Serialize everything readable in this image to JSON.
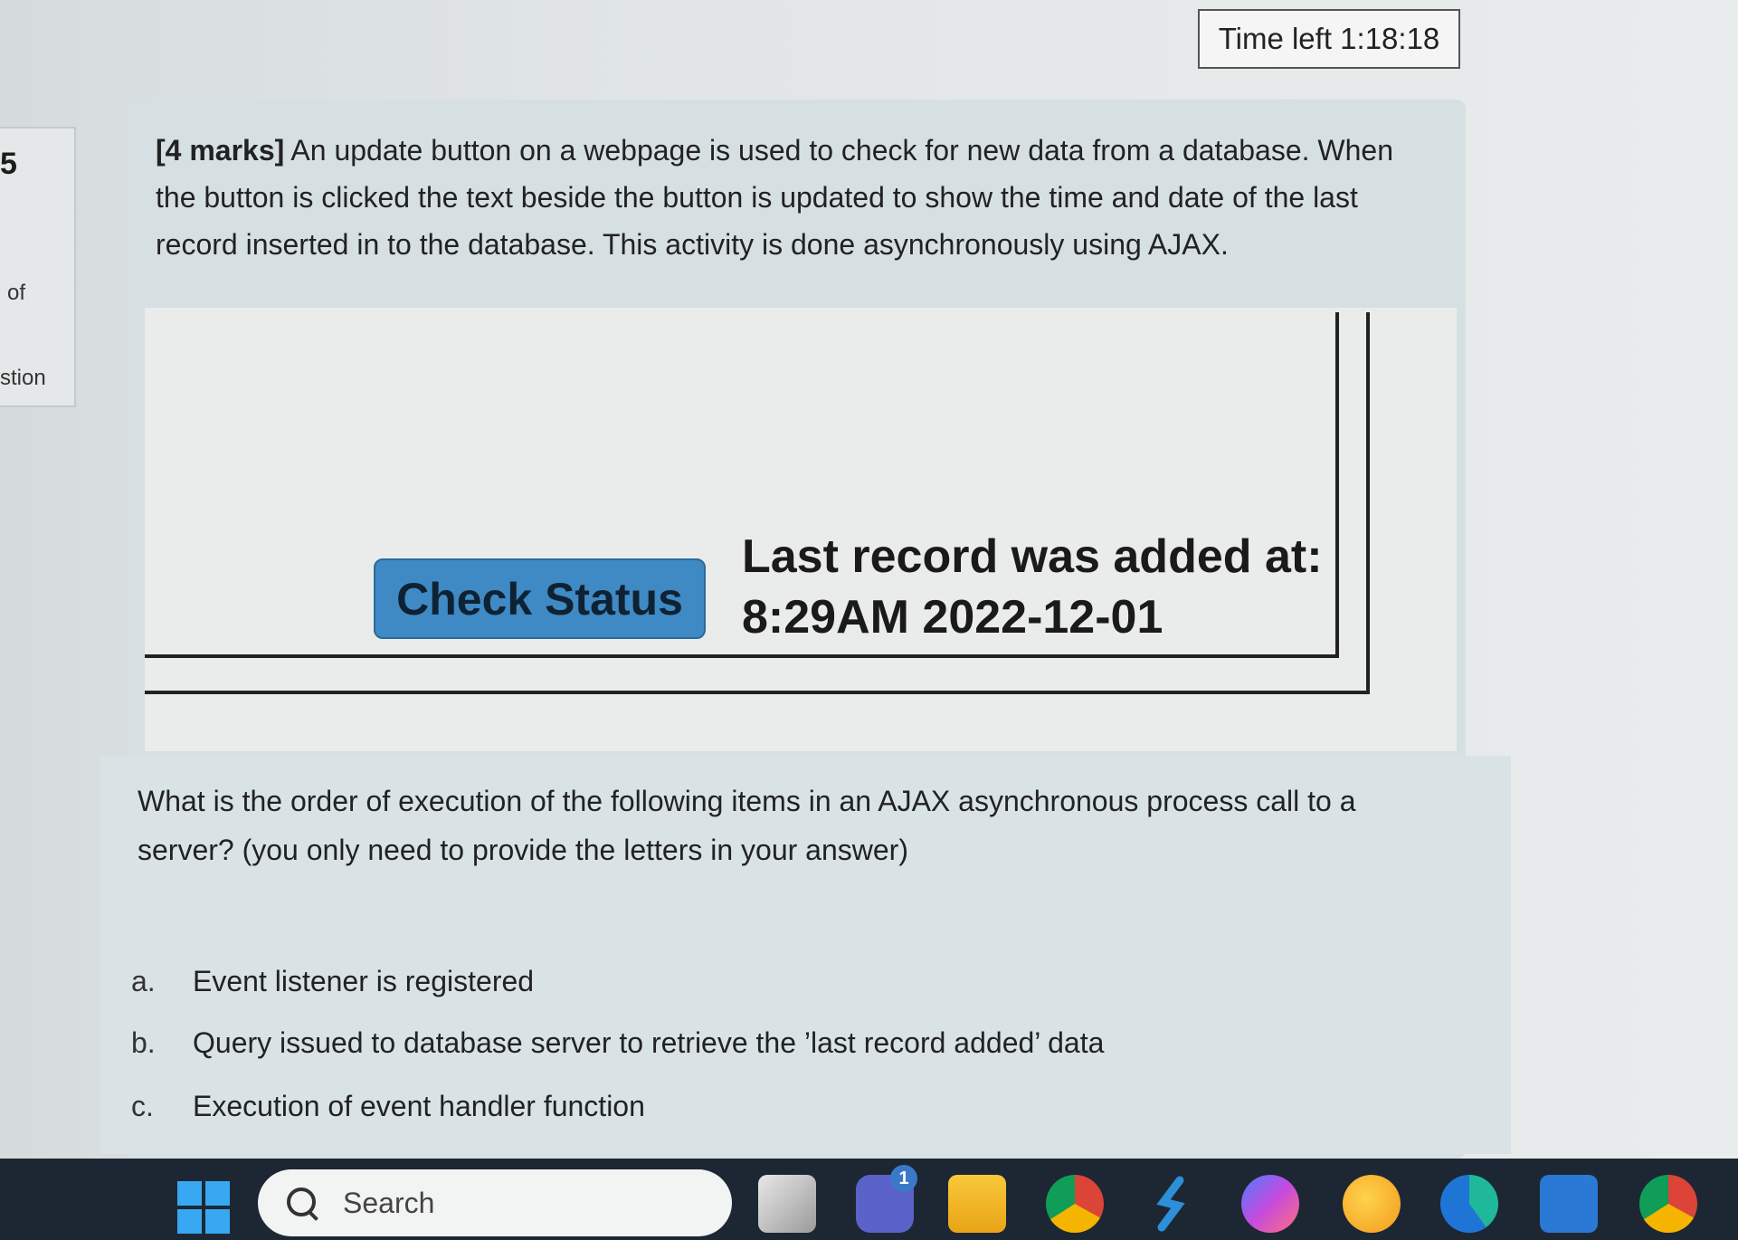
{
  "timer": {
    "text": "Time left 1:18:18"
  },
  "question_nav": {
    "number": "5",
    "of_text": "of",
    "question_text": "stion"
  },
  "question": {
    "marks": "[4 marks]",
    "text": "An update button on a webpage is used to check for new data from a database. When the button is clicked the text beside the button is updated to show the time and date of the last record inserted in to the database. This activity is done asynchronously using AJAX."
  },
  "figure": {
    "button_label": "Check Status",
    "status_label": "Last record was added at:",
    "status_value": "8:29AM 2022-12-01",
    "button_color": "#3f89c4"
  },
  "sub_question": {
    "text": "What is the order of execution of the following items in an AJAX asynchronous process call to a server? (you only need to provide the letters in your answer)"
  },
  "options": [
    {
      "letter": "a.",
      "text": "Event listener is registered"
    },
    {
      "letter": "b.",
      "text": "Query issued to database server to retrieve the ’last record added’ data"
    },
    {
      "letter": "c.",
      "text": "Execution of event handler function"
    }
  ],
  "taskbar": {
    "search_placeholder": "Search",
    "notification_count": "1",
    "apps": [
      "start-icon",
      "task-view-icon",
      "teams-icon",
      "file-explorer-icon",
      "chrome-icon",
      "vscode-icon",
      "messenger-icon",
      "weather-icon",
      "edge-icon",
      "mail-icon",
      "chrome-profile-icon"
    ]
  }
}
